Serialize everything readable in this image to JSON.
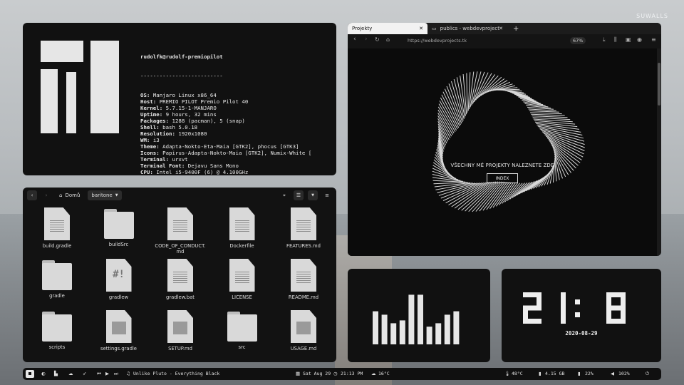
{
  "watermark": "SUWALLS",
  "terminal": {
    "user_host": "rudolfk@rudolf-premiopilot",
    "separator": "--------------------------",
    "lines": [
      {
        "key": "OS",
        "value": "Manjaro Linux x86_64"
      },
      {
        "key": "Host",
        "value": "PREMIO PILOT Premio Pilot 40"
      },
      {
        "key": "Kernel",
        "value": "5.7.15-1-MANJARO"
      },
      {
        "key": "Uptime",
        "value": "9 hours, 32 mins"
      },
      {
        "key": "Packages",
        "value": "1288 (pacman), 5 (snap)"
      },
      {
        "key": "Shell",
        "value": "bash 5.0.18"
      },
      {
        "key": "Resolution",
        "value": "1920x1080"
      },
      {
        "key": "WM",
        "value": "i3"
      },
      {
        "key": "Theme",
        "value": "Adapta-Nokto-Eta-Maia [GTK2], phocus [GTK3]"
      },
      {
        "key": "Icons",
        "value": "Papirus-Adapta-Nokto-Maia [GTK2], Numix-White ["
      },
      {
        "key": "Terminal",
        "value": "urxvt"
      },
      {
        "key": "Terminal Font",
        "value": "Dejavu Sans Mono"
      },
      {
        "key": "CPU",
        "value": "Intel i5-9400F (6) @ 4.100GHz"
      },
      {
        "key": "GPU",
        "value": "NVIDIA GeForce GTX 1060 6GB"
      },
      {
        "key": "Memory",
        "value": "4583MiB / 7901MiB"
      }
    ]
  },
  "file_manager": {
    "breadcrumb_home": "Domů",
    "breadcrumb_current": "baritone",
    "files": [
      {
        "name": "build.gradle",
        "icon": "text-file-icon"
      },
      {
        "name": "buildSrc",
        "icon": "folder-icon"
      },
      {
        "name": "CODE_OF_CONDUCT.\nmd",
        "icon": "text-file-icon"
      },
      {
        "name": "Dockerfile",
        "icon": "text-file-icon"
      },
      {
        "name": "FEATURES.md",
        "icon": "text-file-icon"
      },
      {
        "name": "gradle",
        "icon": "folder-icon"
      },
      {
        "name": "gradlew",
        "icon": "script-file-icon"
      },
      {
        "name": "gradlew.bat",
        "icon": "text-file-icon"
      },
      {
        "name": "LICENSE",
        "icon": "text-file-icon"
      },
      {
        "name": "README.md",
        "icon": "text-file-icon"
      },
      {
        "name": "scripts",
        "icon": "folder-icon"
      },
      {
        "name": "settings.gradle",
        "icon": "generic-file-icon"
      },
      {
        "name": "SETUP.md",
        "icon": "generic-file-icon"
      },
      {
        "name": "src",
        "icon": "folder-icon"
      },
      {
        "name": "USAGE.md",
        "icon": "generic-file-icon"
      }
    ]
  },
  "browser": {
    "tab1": "Projekty",
    "tab2": "publics - webdevproject",
    "new_tab": "+",
    "close": "✕",
    "url": "https://webdevprojects.tk",
    "zoom": "67%",
    "hero_text": "VŠECHNY MÉ PROJEKTY NALEZNETE ZDE",
    "button": "INDEX"
  },
  "visualizer": {
    "levels": [
      0.58,
      0.52,
      0.37,
      0.42,
      0.87,
      0.87,
      0.31,
      0.37,
      0.52,
      0.58
    ]
  },
  "clock": {
    "time_digits": [
      "2",
      "1",
      ":",
      "1",
      "3"
    ],
    "date": "2020-08-29"
  },
  "statusbar": {
    "now_playing": "Unlike Pluto - Everything Black",
    "date": "Sat Aug 29",
    "time": "21:13 PM",
    "weather": "16°C",
    "cpu_temp": "48°C",
    "disk": "4.15 GB",
    "brightness": "22%",
    "volume": "102%"
  },
  "colors": {
    "panel": "#111111",
    "accent": "#e6e6e6"
  }
}
